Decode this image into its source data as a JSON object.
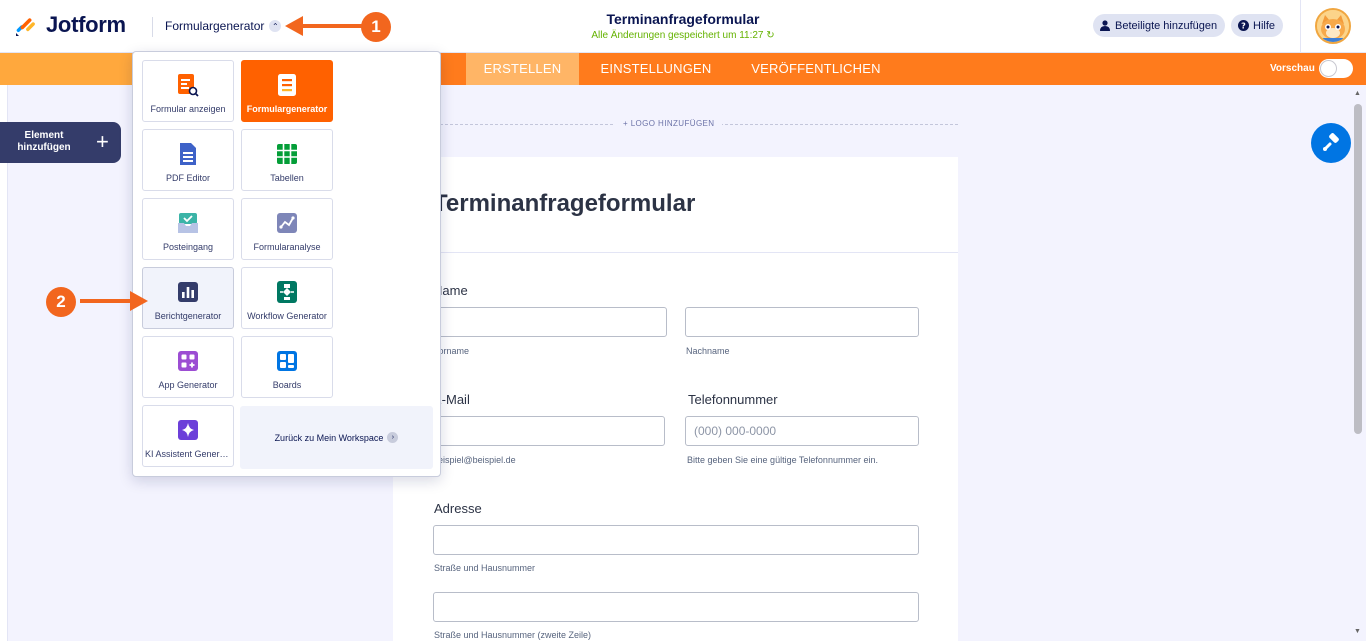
{
  "header": {
    "brand": "Jotform",
    "app_switcher": "Formulargenerator",
    "form_title": "Terminanfrageformular",
    "save_status": "Alle Änderungen gespeichert um 11:27",
    "add_participants": "Beteiligte hinzufügen",
    "help": "Hilfe"
  },
  "nav": {
    "tabs": [
      "ERSTELLEN",
      "EINSTELLUNGEN",
      "VERÖFFENTLICHEN"
    ],
    "preview": "Vorschau",
    "active_color": "#ffb566",
    "bar_color": "#ff7b1c"
  },
  "left": {
    "add_element": "Element hinzufügen"
  },
  "canvas": {
    "add_logo": "+ LOGO HINZUFÜGEN",
    "heading": "Terminanfrageformular",
    "name_label": "Name",
    "first_name": "Vorname",
    "last_name": "Nachname",
    "email_label": "E-Mail",
    "email_hint": "beispiel@beispiel.de",
    "phone_label": "Telefonnummer",
    "phone_placeholder": "(000) 000-0000",
    "phone_hint": "Bitte geben Sie eine gültige Telefonnummer ein.",
    "address_label": "Adresse",
    "street": "Straße und Hausnummer",
    "street2": "Straße und Hausnummer (zweite Zeile)"
  },
  "dropdown": {
    "tiles": [
      {
        "label": "Formular anzeigen",
        "icon": "form-view-icon"
      },
      {
        "label": "Formulargenerator",
        "icon": "form-builder-icon"
      },
      {
        "label": "PDF Editor",
        "icon": "pdf-editor-icon"
      },
      {
        "label": "Tabellen",
        "icon": "tables-icon"
      },
      {
        "label": "Posteingang",
        "icon": "inbox-icon"
      },
      {
        "label": "Formularanalyse",
        "icon": "analytics-icon"
      },
      {
        "label": "Berichtgenerator",
        "icon": "report-builder-icon"
      },
      {
        "label": "Workflow Generator",
        "icon": "workflow-icon"
      },
      {
        "label": "App Generator",
        "icon": "app-builder-icon"
      },
      {
        "label": "Boards",
        "icon": "boards-icon"
      },
      {
        "label": "KI Assistent Generator",
        "icon": "ai-agent-icon"
      }
    ],
    "back_to_workspace": "Zurück zu Mein Workspace"
  },
  "annotations": {
    "step1": "1",
    "step2": "2",
    "color": "#f2661e"
  }
}
